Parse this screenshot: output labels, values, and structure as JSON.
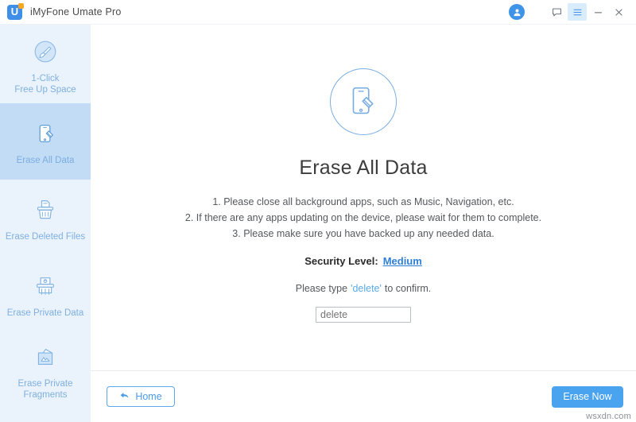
{
  "window": {
    "title": "iMyFone Umate Pro",
    "logo_letter": "U",
    "logo_color": "#3f8fe8",
    "logo_accent_color": "#f6a623"
  },
  "titlebar": {
    "avatar_icon": "user-avatar-icon",
    "buttons": [
      {
        "name": "feedback-icon",
        "label": ""
      },
      {
        "name": "menu-icon",
        "label": ""
      },
      {
        "name": "minimize-icon",
        "label": ""
      },
      {
        "name": "close-icon",
        "label": ""
      }
    ]
  },
  "sidebar": {
    "background": "#eaf2fc",
    "selected_background": "#c3dcf6",
    "items": [
      {
        "key": "free-up-space",
        "label": "1-Click\nFree Up Space",
        "icon": "broom-circle-icon",
        "selected": false
      },
      {
        "key": "erase-all-data",
        "label": "Erase All Data",
        "icon": "phone-eraser-icon",
        "selected": true
      },
      {
        "key": "erase-deleted-files",
        "label": "Erase Deleted Files",
        "icon": "trash-bin-icon",
        "selected": false
      },
      {
        "key": "erase-private-data",
        "label": "Erase Private Data",
        "icon": "shredder-icon",
        "selected": false
      },
      {
        "key": "erase-private-fragments",
        "label": "Erase Private\nFragments",
        "icon": "folder-fragments-icon",
        "selected": false
      }
    ]
  },
  "main": {
    "hero_icon": "phone-eraser-circle-icon",
    "heading": "Erase All Data",
    "instructions": [
      "1. Please close all background apps, such as Music, Navigation, etc.",
      "2. If there are any apps updating on the device, please wait for them to complete.",
      "3. Please make sure you have backed up any needed data."
    ],
    "security": {
      "label": "Security Level:",
      "value": "Medium",
      "value_color": "#2f7fd8"
    },
    "confirm": {
      "prefix": "Please type",
      "keyword": "'delete'",
      "suffix": "to confirm.",
      "keyword_color": "#5aa9ea"
    },
    "input": {
      "value": "",
      "placeholder": "delete"
    }
  },
  "footer": {
    "home_label": "Home",
    "home_icon": "back-arrow-icon",
    "erase_label": "Erase Now",
    "accent_color": "#4aa3ef"
  },
  "watermark": "wsxdn.com"
}
